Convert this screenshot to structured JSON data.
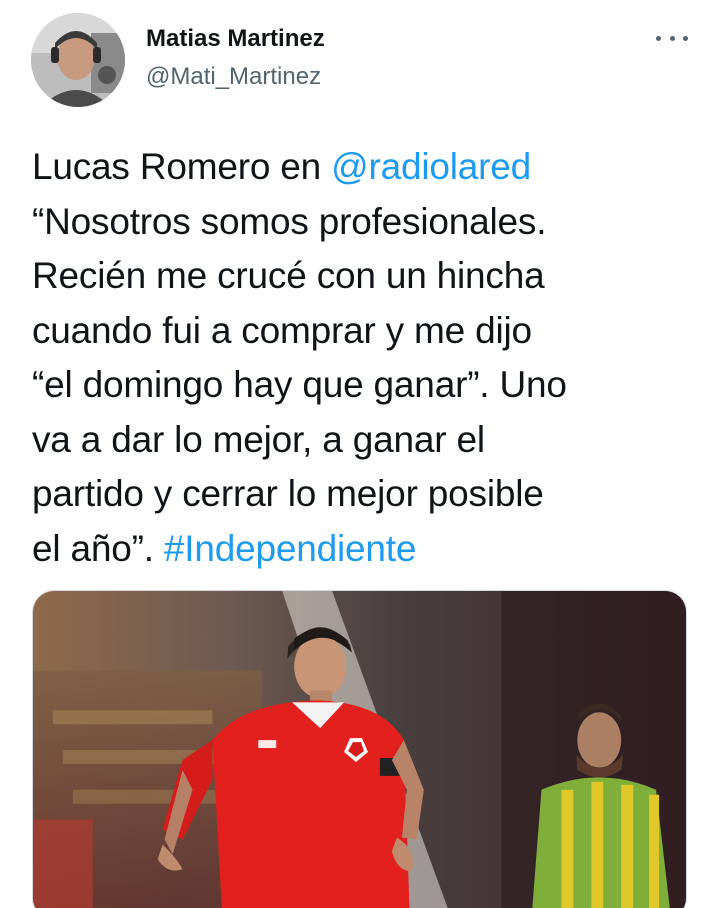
{
  "author": {
    "name": "Matias Martinez",
    "handle": "@Mati_Martinez"
  },
  "tweet": {
    "segments": [
      {
        "text": "Lucas Romero en ",
        "type": "text"
      },
      {
        "text": "@radiolared",
        "type": "mention"
      },
      {
        "text": "\n“Nosotros somos profesionales.\nRecién me crucé con un hincha\ncuando fui a comprar y me dijo\n“el domingo hay que ganar”. Uno\nva a dar lo mejor, a ganar el\npartido y cerrar lo mejor posible\nel año”. ",
        "type": "text"
      },
      {
        "text": "#Independiente",
        "type": "hashtag"
      }
    ]
  },
  "colors": {
    "link": "#1d9bf0",
    "handle": "#536471",
    "text": "#0f1419"
  },
  "icons": {
    "more": "more-horizontal-icon"
  }
}
